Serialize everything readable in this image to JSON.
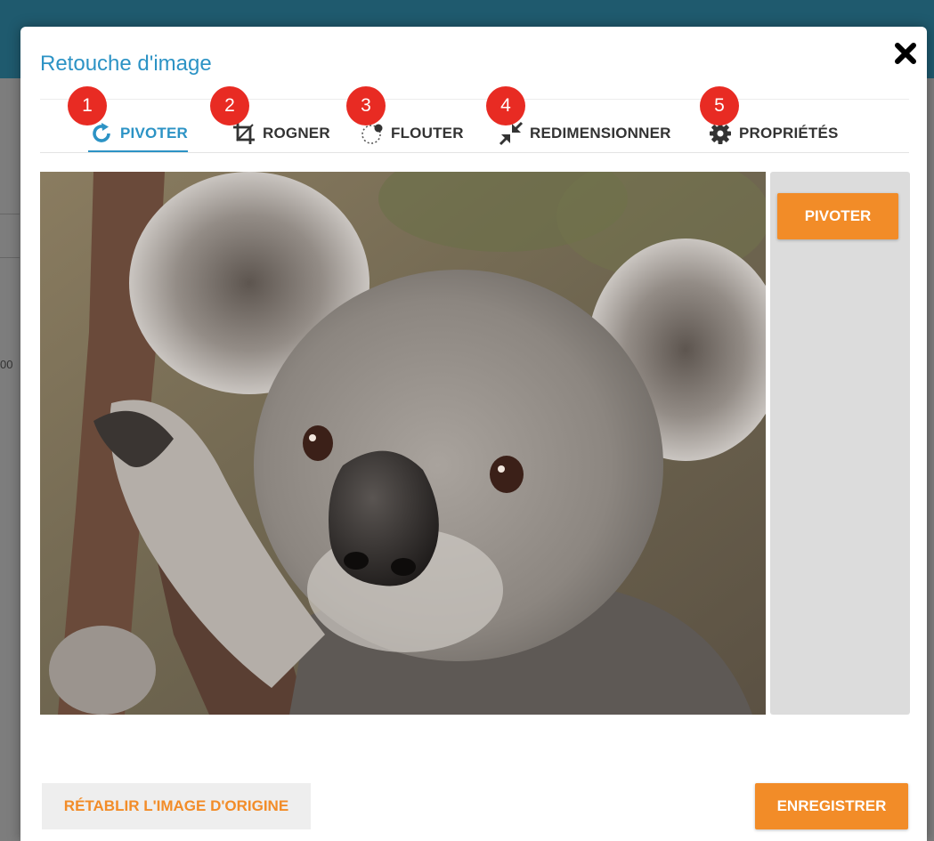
{
  "modal": {
    "title": "Retouche d'image",
    "close_icon": "close-x-icon"
  },
  "background_page": {
    "partial_text": "00"
  },
  "tabs": [
    {
      "label": "PIVOTER",
      "icon": "rotate-icon",
      "badge": "1",
      "active": true
    },
    {
      "label": "ROGNER",
      "icon": "crop-icon",
      "badge": "2",
      "active": false
    },
    {
      "label": "FLOUTER",
      "icon": "blur-icon",
      "badge": "3",
      "active": false
    },
    {
      "label": "REDIMENSIONNER",
      "icon": "resize-icon",
      "badge": "4",
      "active": false
    },
    {
      "label": "PROPRIÉTÉS",
      "icon": "gear-icon",
      "badge": "5",
      "active": false
    }
  ],
  "side_panel": {
    "action_label": "PIVOTER"
  },
  "footer": {
    "reset_label": "RÉTABLIR L'IMAGE D'ORIGINE",
    "save_label": "ENREGISTRER"
  },
  "colors": {
    "accent": "#2c93c5",
    "button_orange": "#f28c28",
    "badge_red": "#e82b23",
    "panel_gray": "#dcdcdc"
  }
}
